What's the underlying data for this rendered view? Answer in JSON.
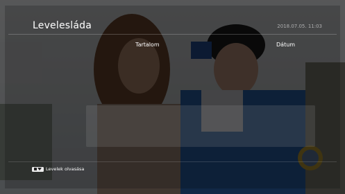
{
  "header": {
    "title": "Levelesláda",
    "datetime": "2018.07.05. 11:03"
  },
  "columns": {
    "content": "Tartalom",
    "date": "Dátum"
  },
  "messages": [],
  "footer": {
    "hint_icon": "remote-key-icon",
    "hint_label": "Levelek olvasása"
  },
  "colors": {
    "text": "#ffffff",
    "datetime": "#8c8c8c",
    "overlay": "rgba(0,0,0,0.64)"
  }
}
